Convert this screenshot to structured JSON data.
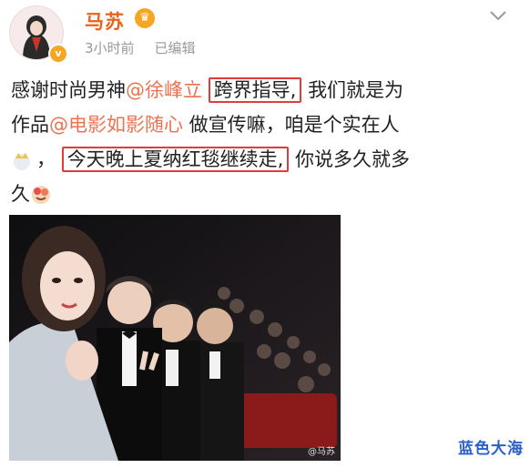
{
  "post": {
    "author": "马苏",
    "time": "3小时前",
    "edited": "已编辑",
    "line1_pre": "感谢时尚男神",
    "mention1": "@徐峰立",
    "box1": "跨界指导,",
    "line1_post": "我们就是为",
    "line2_pre": "作品",
    "mention2": "@电影如影随心",
    "line2_post": " 做宣传嘛，咱是个实在人",
    "line3_sep": "，",
    "box2": "今天晚上夏纳红毯继续走,",
    "line3_post": " 你说多久就多",
    "line4": "久"
  },
  "photo": {
    "watermark_small": "@马苏"
  },
  "watermark": "蓝色大海",
  "icons": [
    "avatar",
    "verified-badge-icon",
    "crown-icon",
    "chevron-down-icon",
    "crown-emoji-icon",
    "flower-emoji-icon"
  ],
  "colors": {
    "mention": "#eb7350",
    "username": "#e8641b",
    "highlight_box": "#e23b3b",
    "watermark": "#2b5fcc"
  }
}
